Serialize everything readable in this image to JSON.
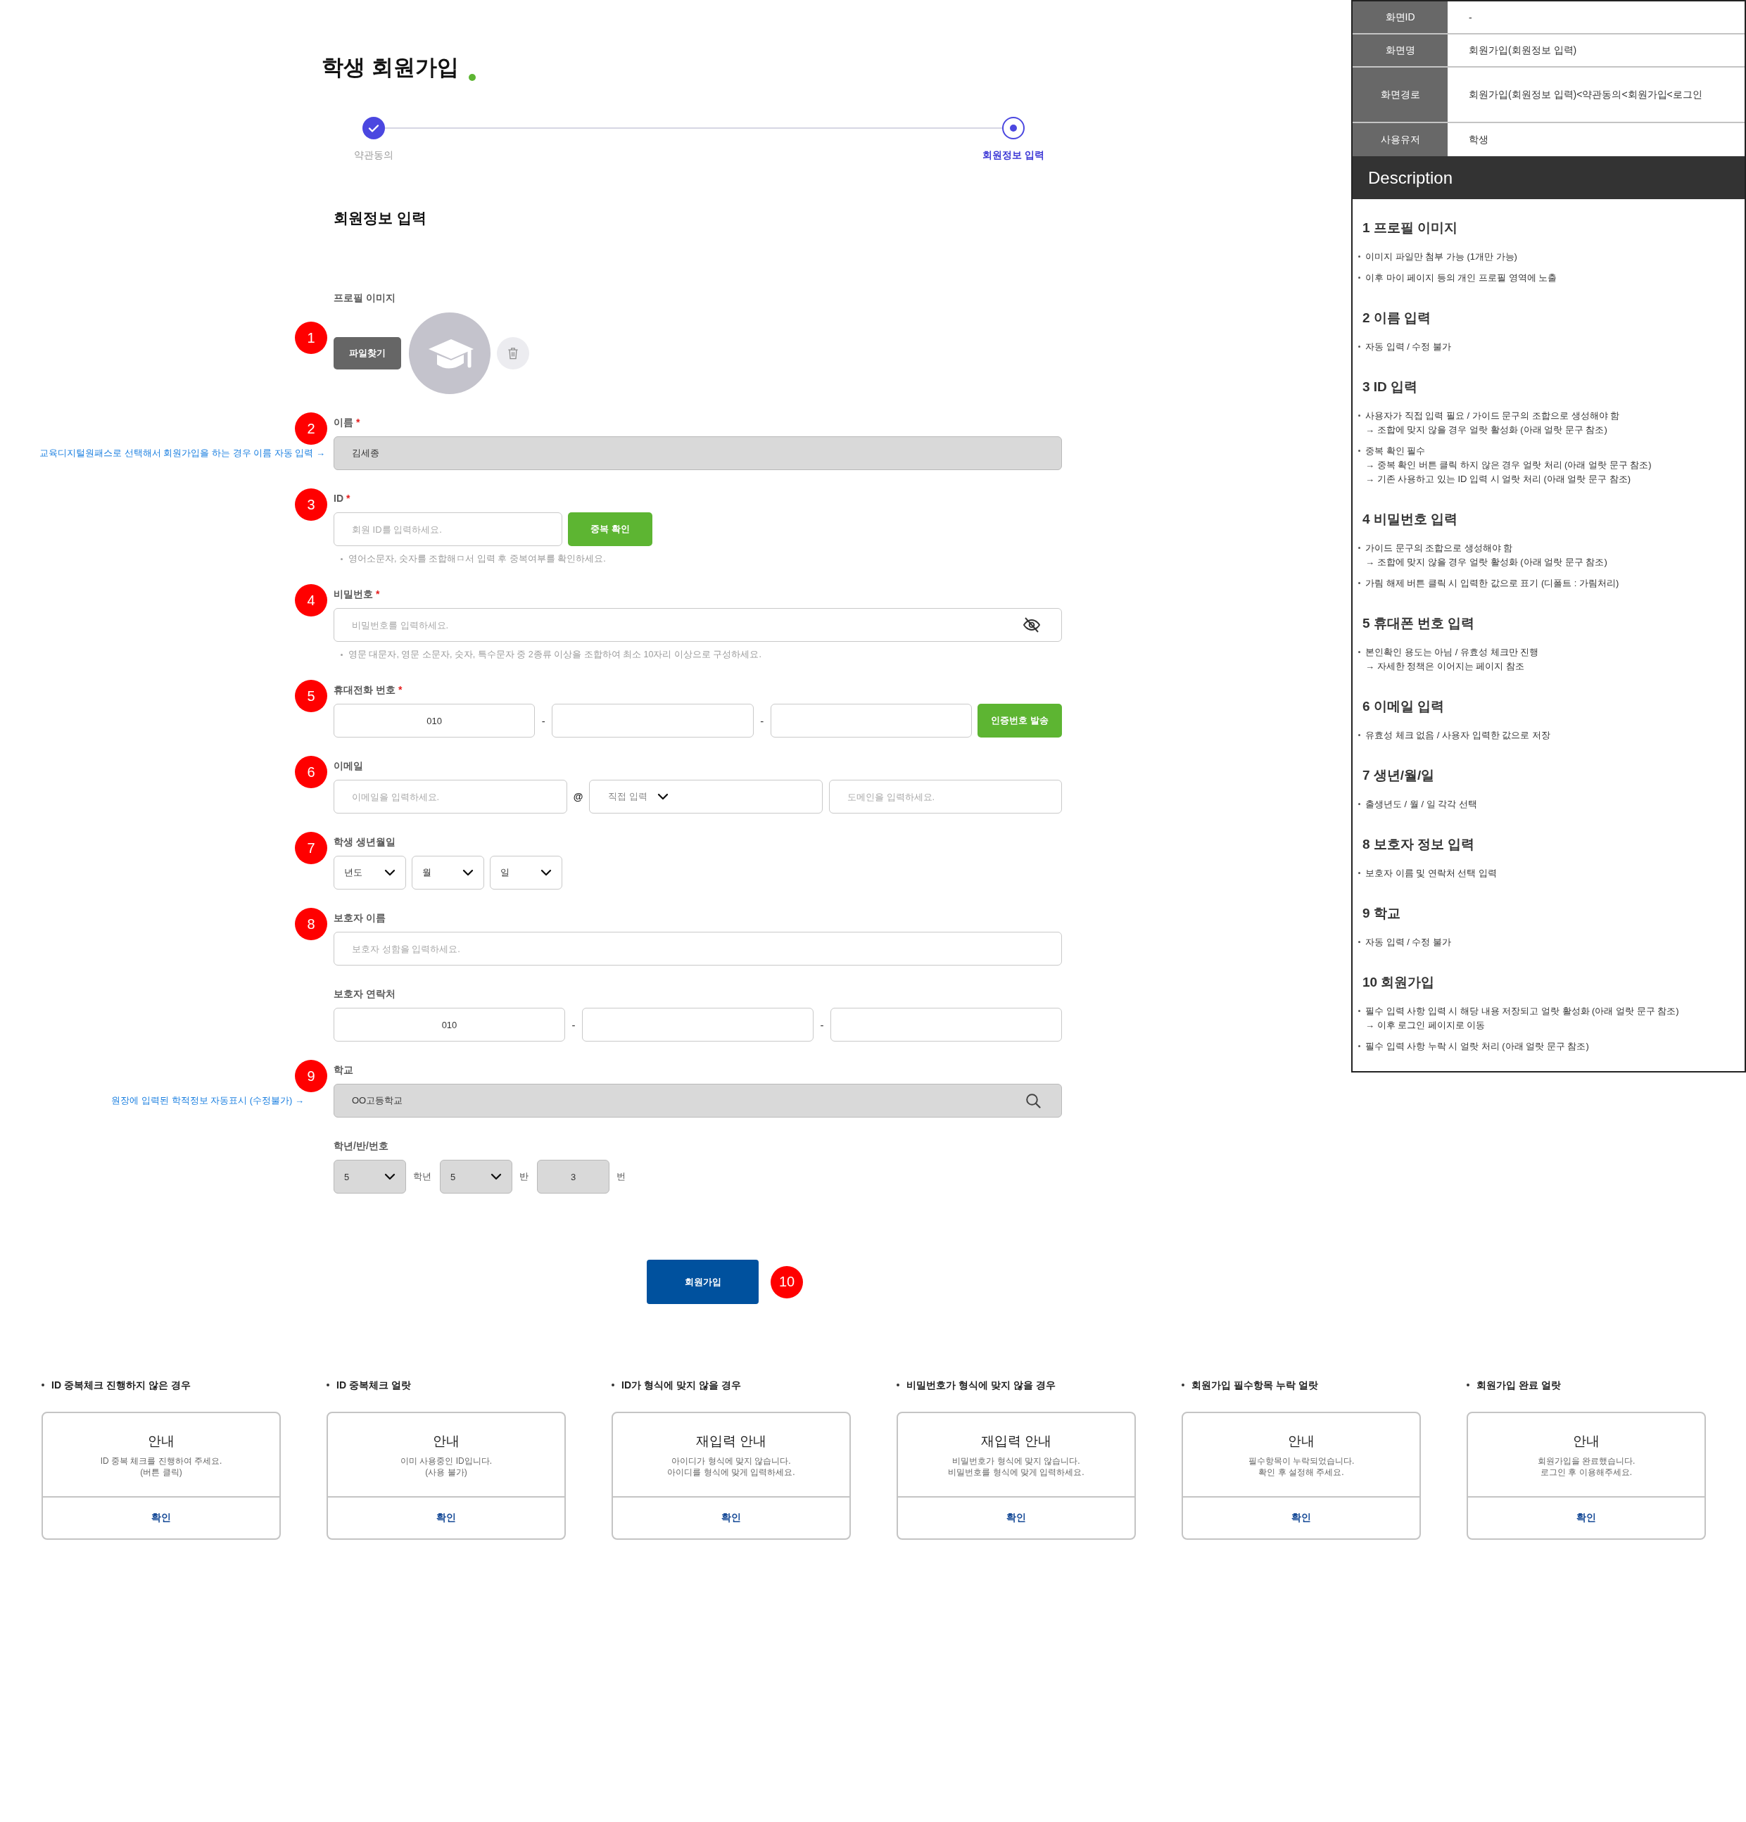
{
  "title": "학생 회원가입",
  "steps": [
    {
      "label": "약관동의",
      "completed": true,
      "selected": false
    },
    {
      "label": "회원정보 입력",
      "completed": false,
      "selected": true
    }
  ],
  "section_title": "회원정보 입력",
  "form": [
    {
      "kind": "profile",
      "marker": "1",
      "label": "프로필 이미지",
      "button": "파일찾기"
    },
    {
      "kind": "text",
      "marker": "2",
      "label": "이름",
      "required_mark": "*",
      "value": "김세종",
      "disabled": true,
      "note": "교육디지털원패스로 선택해서 회원가입을 하는 경우 이름 자동 입력 →"
    },
    {
      "kind": "id",
      "marker": "3",
      "label": "ID",
      "required_mark": "*",
      "placeholder": "회원 ID를 입력하세요.",
      "button": "중복 확인",
      "hint": "영어소문자, 숫자를 조합해ㅁ서 입력 후 중복여부를 확인하세요."
    },
    {
      "kind": "password",
      "marker": "4",
      "label": "비밀번호",
      "required_mark": "*",
      "placeholder": "비밀번호를 입력하세요.",
      "hint": "영문 대문자, 영문 소문자, 숫자, 특수문자 중 2종류 이상을 조합하여 최소 10자리 이상으로 구성하세요."
    },
    {
      "kind": "phone",
      "marker": "5",
      "label": "휴대전화 번호",
      "required_mark": "*",
      "value": "010",
      "separators": [
        "-",
        "-"
      ],
      "button": "인증번호 발송"
    },
    {
      "kind": "email",
      "marker": "6",
      "label": "이메일",
      "placeholder": "이메일을 입력하세요.",
      "at": "@",
      "domain_select": "직접 입력",
      "domain_placeholder": "도메인을 입력하세요."
    },
    {
      "kind": "date",
      "marker": "7",
      "label": "학생 생년월일",
      "selects": [
        "년도",
        "월",
        "일"
      ]
    },
    {
      "kind": "text",
      "marker": "8",
      "label": "보호자 이름",
      "placeholder": "보호자 성함을 입력하세요.",
      "disabled": false
    },
    {
      "kind": "phone",
      "label": "보호자 연락처",
      "value": "010",
      "separators": [
        "-",
        "-"
      ]
    },
    {
      "kind": "search",
      "marker": "9",
      "label": "학교",
      "value": "OO고등학교",
      "disabled": true,
      "note": "원장에 입력된 학적정보 자동표시 (수정불가) →"
    },
    {
      "kind": "class",
      "label": "학년/반/번호",
      "disabled": true,
      "parts": [
        {
          "kind": "select",
          "value": "5",
          "unit": "학년"
        },
        {
          "kind": "select",
          "value": "5",
          "unit": "반"
        },
        {
          "kind": "input",
          "value": "3",
          "unit": "번"
        }
      ]
    }
  ],
  "submit": {
    "label": "회원가입",
    "marker": "10"
  },
  "screen_info": [
    {
      "label": "화면ID",
      "value": "-"
    },
    {
      "label": "화면명",
      "value": "회원가입(회원정보 입력)"
    },
    {
      "label": "화면경로",
      "value": "회원가입(회원정보 입력)<약관동의<회원가입<로그인"
    },
    {
      "label": "사용유저",
      "value": "학생"
    }
  ],
  "description": {
    "title": "Description",
    "sections": [
      {
        "heading": "1 프로필 이미지",
        "items": [
          {
            "lines": [
              "이미지 파일만 첨부 가능 (1개만 가능)"
            ]
          },
          {
            "lines": [
              "이후 마이 페이지 등의 개인 프로필 영역에 노출"
            ]
          }
        ]
      },
      {
        "heading": "2 이름 입력",
        "items": [
          {
            "lines": [
              "자동 입력 / 수정 불가"
            ]
          }
        ]
      },
      {
        "heading": "3 ID 입력",
        "items": [
          {
            "lines": [
              "사용자가 직접 입력 필요 / 가이드 문구의 조합으로 생성해야 함",
              "→ 조합에 맞지 않을 경우 얼랏 활성화 (아래 얼랏 문구 참조)"
            ]
          },
          {
            "lines": [
              "중복 확인 필수",
              "→ 중복 확인 버튼 클릭 하지 않은 경우 얼랏 처리 (아래 얼랏 문구 참조)",
              "→ 기존 사용하고 있는 ID 입력 시 얼랏 처리 (아래 얼랏 문구 참조)"
            ]
          }
        ]
      },
      {
        "heading": "4 비밀번호 입력",
        "items": [
          {
            "lines": [
              "가이드 문구의 조합으로 생성해야 함",
              "→ 조합에 맞지 않을 경우 얼랏 활성화 (아래 얼랏 문구 참조)"
            ]
          },
          {
            "lines": [
              "가림 해제 버튼 클릭 시 입력한 값으로 표기 (디폴트 : 가림처리)"
            ]
          }
        ]
      },
      {
        "heading": "5 휴대폰 번호 입력",
        "items": [
          {
            "lines": [
              "본인확인 용도는 아님 / 유효성 체크만 진행",
              "→ 자세한 정책은 이어지는 페이지 참조"
            ]
          }
        ]
      },
      {
        "heading": "6 이메일 입력",
        "items": [
          {
            "lines": [
              "유효성 체크 없음 / 사용자 입력한 값으로 저장"
            ]
          }
        ]
      },
      {
        "heading": "7 생년/월/일",
        "items": [
          {
            "lines": [
              "출생년도 / 월 / 일 각각 선택"
            ]
          }
        ]
      },
      {
        "heading": "8 보호자 정보 입력",
        "items": [
          {
            "lines": [
              "보호자 이름 및 연락처 선택 입력"
            ]
          }
        ]
      },
      {
        "heading": "9 학교",
        "items": [
          {
            "lines": [
              "자동 입력 / 수정 불가"
            ]
          }
        ]
      },
      {
        "heading": "10 회원가입",
        "items": [
          {
            "lines": [
              "필수 입력 사항 입력 시 해당 내용 저장되고 얼랏 활성화 (아래 얼랏 문구 참조)",
              "→ 이후 로그인 페이지로 이동"
            ]
          },
          {
            "lines": [
              "필수 입력 사항 누락 시 얼랏 처리 (아래 얼랏 문구 참조)"
            ]
          }
        ]
      }
    ]
  },
  "alerts": [
    {
      "caption": "ID 중복체크 진행하지 않은 경우",
      "title": "안내",
      "message": [
        "ID 중복 체크를 진행하여 주세요.",
        "(버튼 클릭)"
      ],
      "button": "확인"
    },
    {
      "caption": "ID 중복체크 얼랏",
      "title": "안내",
      "message": [
        "이미 사용중인 ID입니다.",
        "(사용 불가)"
      ],
      "button": "확인"
    },
    {
      "caption": "ID가 형식에 맞지 않을 경우",
      "title": "재입력 안내",
      "message": [
        "아이디가 형식에 맞지 않습니다.",
        "아이디를 형식에 맞게 입력하세요."
      ],
      "button": "확인"
    },
    {
      "caption": "비밀번호가 형식에 맞지 않을 경우",
      "title": "재입력 안내",
      "message": [
        "비밀번호가 형식에 맞지 않습니다.",
        "비밀번호를 형식에 맞게 입력하세요."
      ],
      "button": "확인"
    },
    {
      "caption": "회원가입 필수항목 누락 얼랏",
      "title": "안내",
      "message": [
        "필수항목이 누락되었습니다.",
        "확인 후 설정해 주세요."
      ],
      "button": "확인"
    },
    {
      "caption": "회원가입 완료 얼랏",
      "title": "안내",
      "message": [
        "회원가입을 완료했습니다.",
        "로그인 후 이용해주세요."
      ],
      "button": "확인"
    }
  ]
}
